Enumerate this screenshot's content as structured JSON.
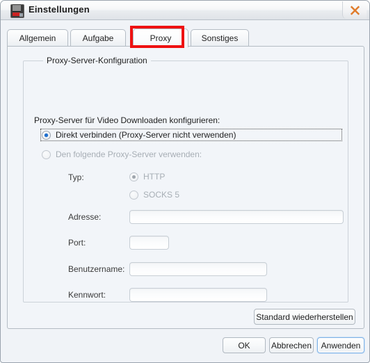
{
  "window": {
    "title": "Einstellungen",
    "icon": "app-icon",
    "close_icon": "close-x-icon",
    "close_color": "#e07b2a"
  },
  "tabs": [
    {
      "label": "Allgemein",
      "selected": false
    },
    {
      "label": "Aufgabe",
      "selected": false
    },
    {
      "label": "Proxy",
      "selected": true
    },
    {
      "label": "Sonstiges",
      "selected": false
    }
  ],
  "annotation": {
    "color": "#ee1111",
    "target": "Proxy"
  },
  "groupbox": {
    "title": "Proxy-Server-Konfiguration",
    "lead_label": "Proxy-Server für Video Downloaden konfigurieren:"
  },
  "connection_mode": {
    "options": [
      {
        "label": "Direkt verbinden (Proxy-Server nicht verwenden)",
        "checked": true,
        "disabled": false,
        "focused": true
      },
      {
        "label": "Den folgende Proxy-Server verwenden:",
        "checked": false,
        "disabled": true,
        "focused": false
      }
    ]
  },
  "proxy_type": {
    "label": "Typ:",
    "options": [
      {
        "label": "HTTP",
        "checked": true,
        "disabled": true
      },
      {
        "label": "SOCKS 5",
        "checked": false,
        "disabled": true
      }
    ]
  },
  "fields": {
    "address": {
      "label": "Adresse:",
      "value": "",
      "placeholder": "",
      "disabled": true
    },
    "port": {
      "label": "Port:",
      "value": "",
      "placeholder": "",
      "disabled": true
    },
    "username": {
      "label": "Benutzername:",
      "value": "",
      "placeholder": "",
      "disabled": true
    },
    "password": {
      "label": "Kennwort:",
      "value": "",
      "placeholder": "",
      "disabled": true
    }
  },
  "buttons": {
    "restore": "Standard wiederherstellen",
    "ok": "OK",
    "cancel": "Abbrechen",
    "apply": "Anwenden",
    "apply_focused": true
  },
  "colors": {
    "accent_blue": "#1d6fd0",
    "panel_bg": "#f2f5f9",
    "annotation_red": "#ee1111",
    "close_orange": "#e07b2a"
  }
}
